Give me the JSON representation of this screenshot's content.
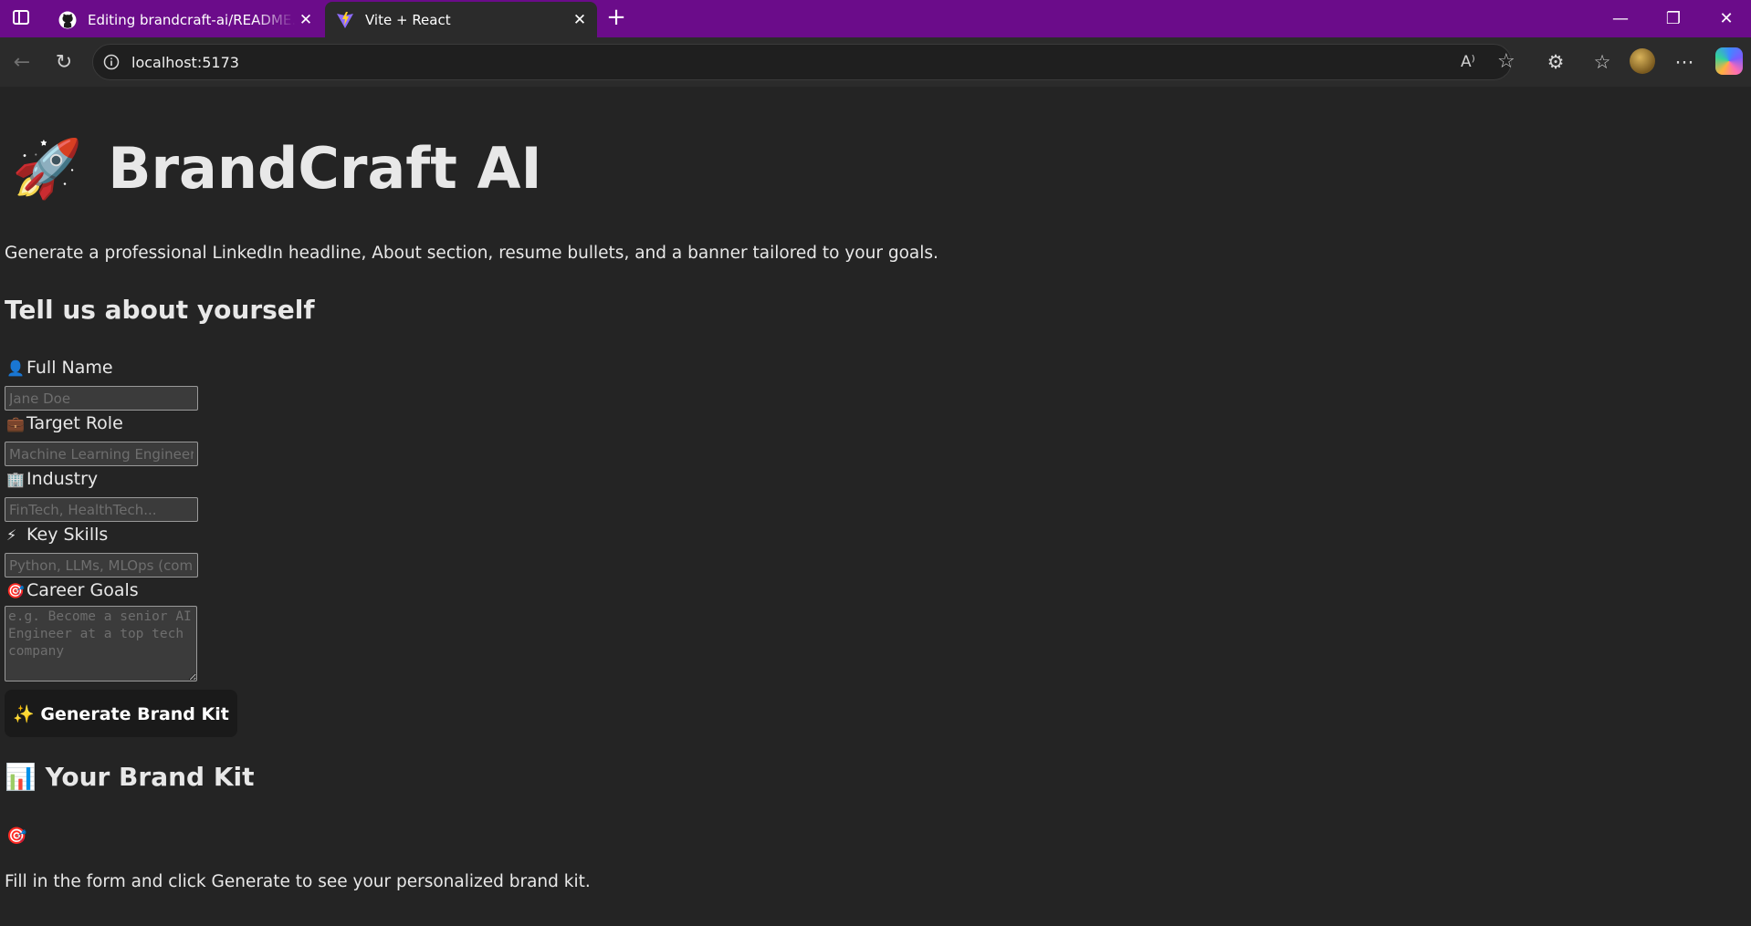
{
  "browser": {
    "tabs": [
      {
        "title": "Editing brandcraft-ai/README.md",
        "icon": "github-icon",
        "active": false
      },
      {
        "title": "Vite + React",
        "icon": "vite-icon",
        "active": true
      }
    ],
    "new_tab_glyph": "+",
    "url": "localhost:5173",
    "read_aloud_glyph": "A⁾",
    "tab_close_glyph": "✕",
    "window": {
      "minimize": "—",
      "maximize": "❐",
      "close": "✕"
    },
    "toolbar_icons": {
      "extensions": "⚙",
      "favorites": "☆",
      "more": "⋯"
    },
    "colors": {
      "tab_strip": "#6b0c8a",
      "toolbar": "#2b2b2b",
      "page_bg": "#242424"
    }
  },
  "app": {
    "title_emoji": "🚀",
    "title": "BrandCraft AI",
    "tagline": "Generate a professional LinkedIn headline, About section, resume bullets, and a banner tailored to your goals.",
    "form_heading": "Tell us about yourself",
    "fields": [
      {
        "icon": "👤",
        "label": "Full Name",
        "placeholder": "Jane Doe",
        "value": ""
      },
      {
        "icon": "💼",
        "label": "Target Role",
        "placeholder": "Machine Learning Engineer",
        "value": ""
      },
      {
        "icon": "🏢",
        "label": "Industry",
        "placeholder": "FinTech, HealthTech...",
        "value": ""
      },
      {
        "icon": "⚡",
        "label": "Key Skills",
        "placeholder": "Python, LLMs, MLOps (comma-separated)",
        "value": ""
      }
    ],
    "goals": {
      "icon": "🎯",
      "label": "Career Goals",
      "placeholder": "e.g. Become a senior AI Engineer at a top tech company",
      "value": ""
    },
    "generate_button": "✨ Generate Brand Kit",
    "kit_heading_icon": "📊",
    "kit_heading": "Your Brand Kit",
    "kit_icon": "🎯",
    "kit_empty_message": "Fill in the form and click Generate to see your personalized brand kit."
  }
}
